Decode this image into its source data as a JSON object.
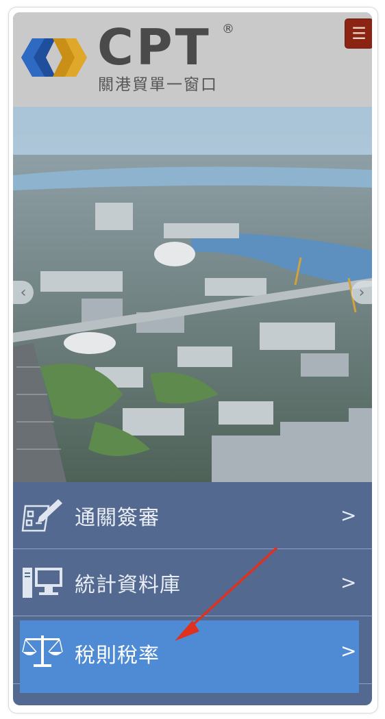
{
  "header": {
    "logo_word": "CPT",
    "logo_reg": "®",
    "logo_subtitle": "關港貿單一窗口",
    "menu_icon": "hamburger-icon"
  },
  "carousel": {
    "prev_symbol": "‹",
    "next_symbol": "›"
  },
  "menu": {
    "items": [
      {
        "label": "通關簽審",
        "icon": "form-pen-icon",
        "chevron": ">"
      },
      {
        "label": "統計資料庫",
        "icon": "computer-icon",
        "chevron": ">"
      },
      {
        "label": "稅則稅率",
        "icon": "scales-icon",
        "chevron": ">",
        "highlighted": true
      }
    ]
  },
  "colors": {
    "header_bg": "#c9c9c9",
    "menu_bg": "#53698f",
    "highlight_bg": "#4f8bd4",
    "menu_button": "#8b2413",
    "annotation_arrow": "#e0301e"
  }
}
